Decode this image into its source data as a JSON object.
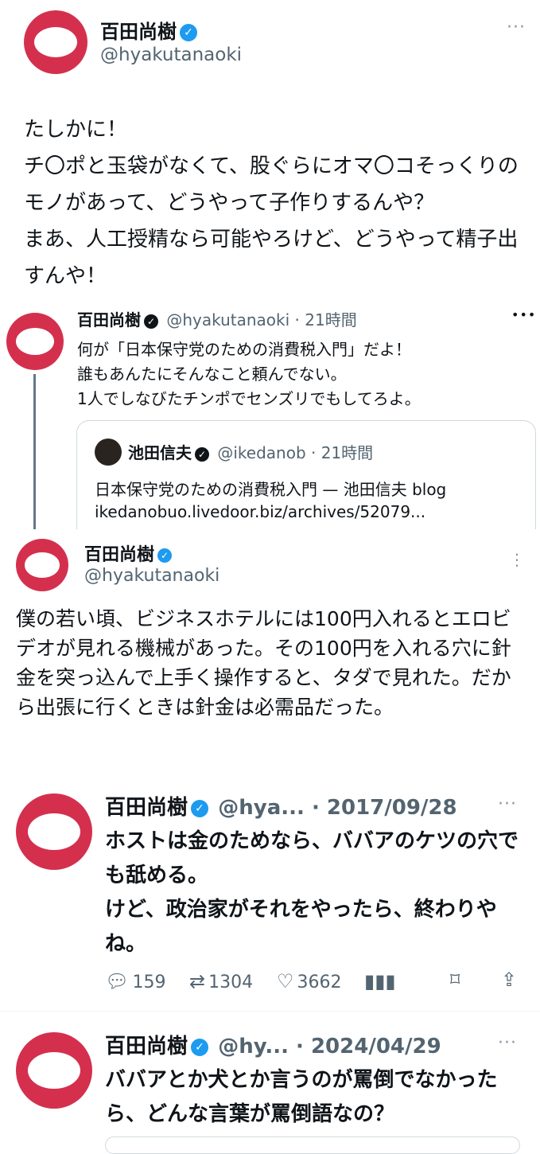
{
  "tweet1": {
    "name": "百田尚樹",
    "handle": "@hyakutanaoki",
    "more": "···",
    "text": "たしかに！\nチ〇ポと玉袋がなくて、股ぐらにオマ〇コそっくりのモノがあって、どうやって子作りするんや？\nまあ、人工授精なら可能やろけど、どうやって精子出すんや！"
  },
  "quoted": {
    "name": "百田尚樹",
    "handle_time": "@hyakutanaoki · 21時間",
    "more": "•••",
    "text": "何が「日本保守党のための消費税入門」だよ！\n誰もあんたにそんなこと頼んでない。\n1人でしなびたチンポでセンズリでもしてろよ。",
    "card": {
      "name": "池田信夫",
      "handle_time": "@ikedanob · 21時間",
      "title": "日本保守党のための消費税入門 — 池田信夫 blog",
      "url": "ikedanobuo.livedoor.biz/archives/52079..."
    }
  },
  "tweet2": {
    "name": "百田尚樹",
    "handle": "@hyakutanaoki",
    "more": "⋮",
    "text": "僕の若い頃、ビジネスホテルには100円入れるとエロビデオが見れる機械があった。その100円を入れる穴に針金を突っ込んで上手く操作すると、タダで見れた。だから出張に行くときは針金は必需品だった。"
  },
  "tweet3": {
    "name": "百田尚樹",
    "handle_date": "@hya... · 2017/09/28",
    "more": "···",
    "text": "ホストは金のためなら、ババアのケツの穴でも舐める。\nけど、政治家がそれをやったら、終わりやね。",
    "replies": "159",
    "retweets": "1304",
    "likes": "3662"
  },
  "tweet4": {
    "name": "百田尚樹",
    "handle_date": "@hy... · 2024/04/29",
    "more": "···",
    "text": "ババアとか犬とか言うのが罵倒でなかったら、どんな言葉が罵倒語なの？"
  },
  "icons": {
    "verified": "✓",
    "reply": "reply-icon",
    "retweet": "retweet-icon",
    "like": "like-icon",
    "views": "views-icon",
    "bookmark": "bookmark-icon",
    "share": "share-icon"
  },
  "colors": {
    "avatar": "#d4304e",
    "verified": "#1d9bf0",
    "muted": "#536471"
  }
}
